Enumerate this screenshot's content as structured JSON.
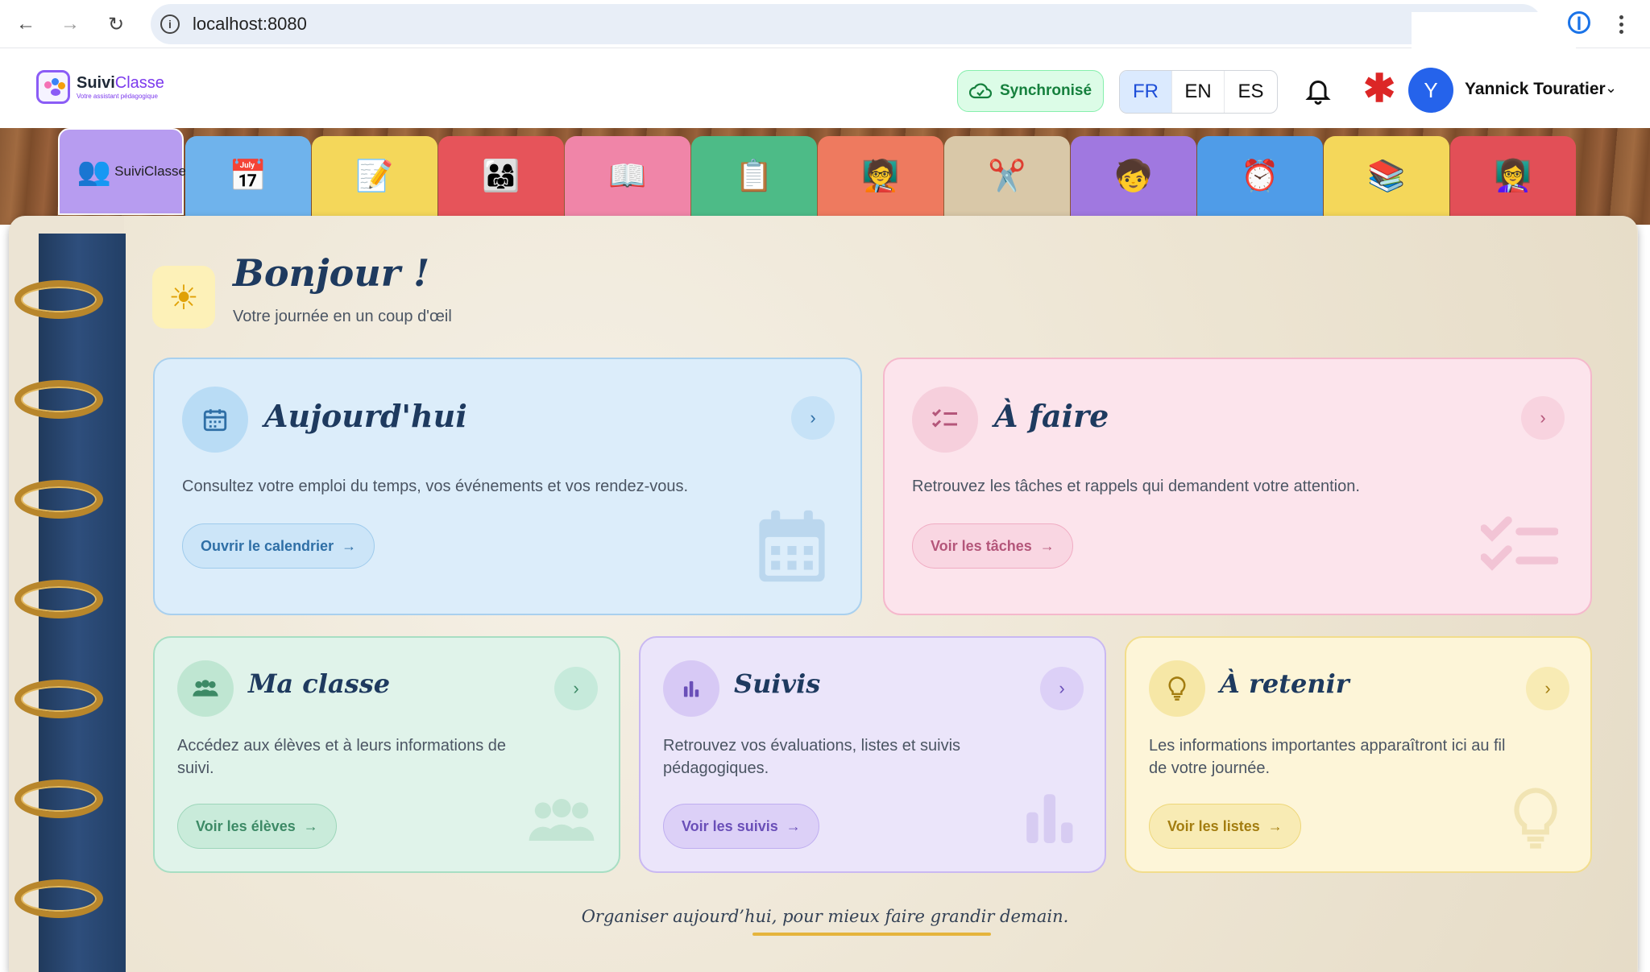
{
  "browser": {
    "url": "localhost:8080",
    "back_icon": "arrow-left-icon",
    "forward_icon": "arrow-right-icon",
    "reload_icon": "reload-icon"
  },
  "header": {
    "logo_name_part1": "Suivi",
    "logo_name_part2": "Classe",
    "logo_tagline": "Votre assistant pédagogique",
    "sync_label": "Synchronisé",
    "languages": [
      "FR",
      "EN",
      "ES"
    ],
    "active_language": "FR",
    "avatar_initial": "Y",
    "user_name": "Yannick Touratier"
  },
  "tabs": {
    "first_label": "SuiviClasse",
    "icons": [
      "home-icon",
      "calendar-icon",
      "notes-icon",
      "students-icon",
      "book-icon",
      "checklist-icon",
      "teacher-board-icon",
      "craft-icon",
      "group-icon",
      "hours-clock-icon",
      "reading-icon",
      "teacher-icon"
    ]
  },
  "greeting": {
    "title": "Bonjour !",
    "subtitle": "Votre journée en un coup d'œil"
  },
  "cards": {
    "today": {
      "title": "Aujourd'hui",
      "description": "Consultez votre emploi du temps, vos événements et vos rendez-vous.",
      "button": "Ouvrir le calendrier"
    },
    "todo": {
      "title": "À faire",
      "description": "Retrouvez les tâches et rappels qui demandent votre attention.",
      "button": "Voir les tâches"
    },
    "class": {
      "title": "Ma classe",
      "description": "Accédez aux élèves et à leurs informations de suivi.",
      "button": "Voir les élèves"
    },
    "tracking": {
      "title": "Suivis",
      "description": "Retrouvez vos évaluations, listes et suivis pédagogiques.",
      "button": "Voir les suivis"
    },
    "remember": {
      "title": "À retenir",
      "description": "Les informations importantes apparaîtront ici au fil de votre journée.",
      "button": "Voir les listes"
    }
  },
  "footer": {
    "quote": "Organiser aujourd’hui, pour mieux faire grandir demain."
  },
  "colors": {
    "accent_blue": "#2563eb",
    "sync_green": "#15803d",
    "title_navy": "#1e3a5f"
  }
}
